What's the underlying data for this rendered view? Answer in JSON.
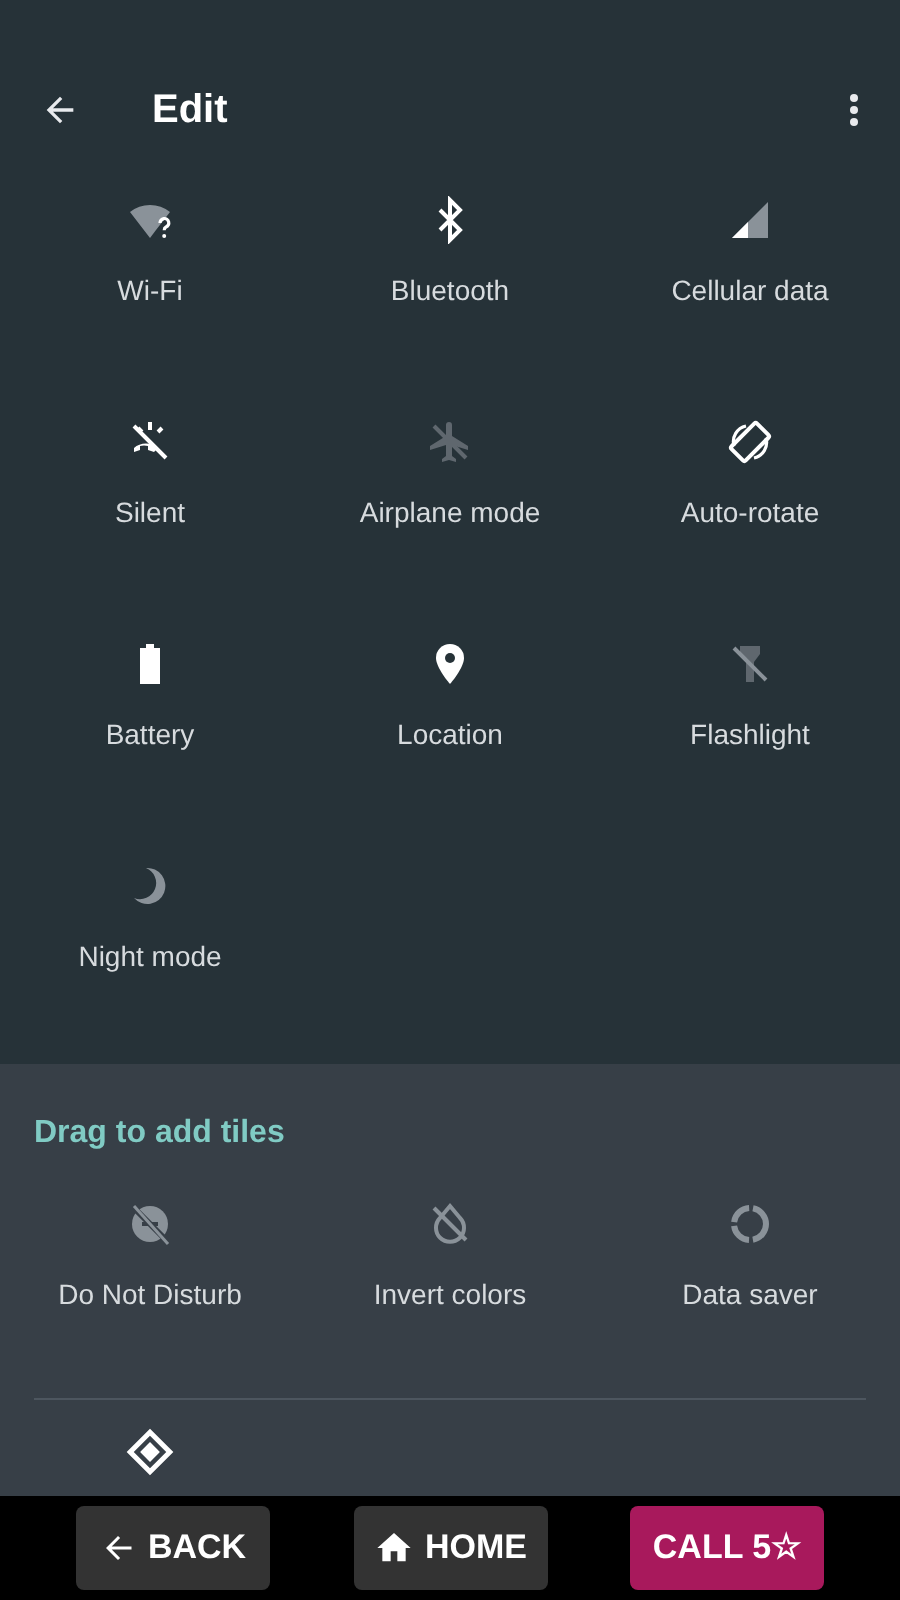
{
  "header": {
    "title": "Edit"
  },
  "tiles": [
    {
      "kind": "wifi",
      "label": "Wi-Fi",
      "on": false
    },
    {
      "kind": "bluetooth",
      "label": "Bluetooth",
      "on": true
    },
    {
      "kind": "cellular",
      "label": "Cellular data",
      "on": false
    },
    {
      "kind": "silent",
      "label": "Silent",
      "on": true
    },
    {
      "kind": "airplane",
      "label": "Airplane mode",
      "on": false
    },
    {
      "kind": "rotate",
      "label": "Auto-rotate",
      "on": true
    },
    {
      "kind": "battery",
      "label": "Battery",
      "on": true
    },
    {
      "kind": "location",
      "label": "Location",
      "on": true
    },
    {
      "kind": "flashlight",
      "label": "Flashlight",
      "on": false
    },
    {
      "kind": "moon",
      "label": "Night mode",
      "on": false
    }
  ],
  "add_section": {
    "title": "Drag to add tiles",
    "tiles": [
      {
        "kind": "dnd",
        "label": "Do Not Disturb",
        "on": false
      },
      {
        "kind": "invert",
        "label": "Invert colors",
        "on": false
      },
      {
        "kind": "saver",
        "label": "Data saver",
        "on": false
      }
    ],
    "more_tiles": [
      {
        "kind": "diamond",
        "on": true
      }
    ]
  },
  "bottom_bar": [
    {
      "kind": "back",
      "label": "BACK"
    },
    {
      "kind": "home",
      "label": "HOME"
    },
    {
      "kind": "call",
      "label": "CALL 5☆"
    }
  ]
}
